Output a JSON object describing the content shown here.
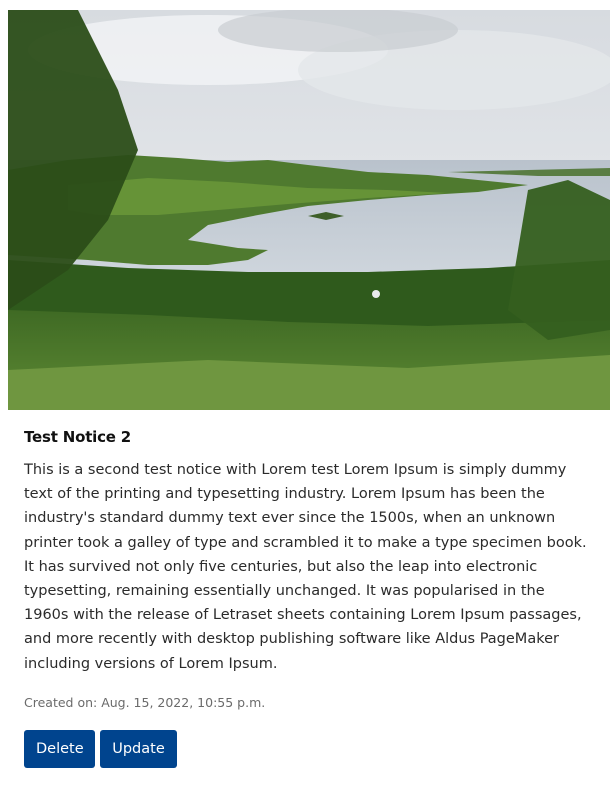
{
  "notice": {
    "title": "Test Notice 2",
    "body": "This is a second test notice with Lorem test Lorem Ipsum is simply dummy text of the printing and typesetting industry. Lorem Ipsum has been the industry's standard dummy text ever since the 1500s, when an unknown printer took a galley of type and scrambled it to make a type specimen book. It has survived not only five centuries, but also the leap into electronic typesetting, remaining essentially unchanged. It was popularised in the 1960s with the release of Letraset sheets containing Lorem Ipsum passages, and more recently with desktop publishing software like Aldus PageMaker including versions of Lorem Ipsum.",
    "created": "Created on: Aug. 15, 2022, 10:55 p.m."
  },
  "actions": {
    "delete_label": "Delete",
    "update_label": "Update"
  },
  "colors": {
    "button_bg": "#00448e",
    "button_text": "#ffffff"
  }
}
